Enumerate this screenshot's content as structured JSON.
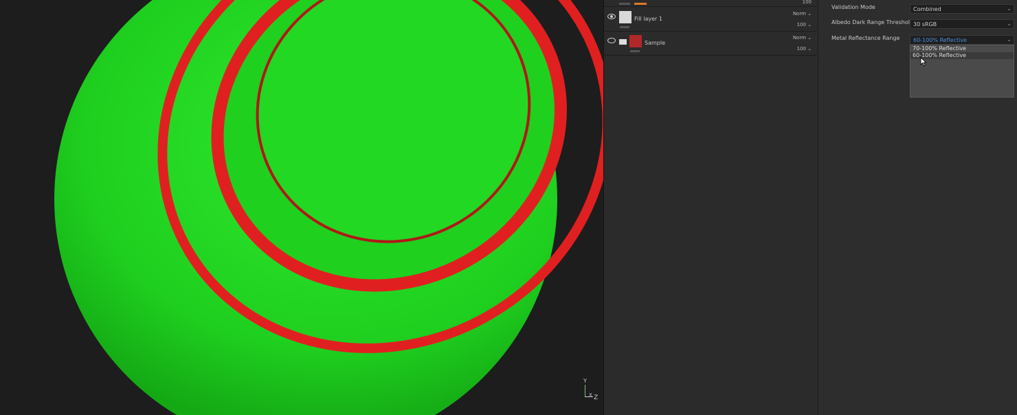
{
  "viewport": {
    "axis": {
      "y": "Y",
      "x": "X",
      "z": "Z"
    },
    "colors": {
      "valid": "#22dd22",
      "invalid": "#e02020"
    }
  },
  "layers": {
    "top_partial": {
      "opacity": "100"
    },
    "items": [
      {
        "name": "Fill layer 1",
        "blend": "Norm",
        "opacity": "100",
        "visible": true
      },
      {
        "name": "Sample",
        "blend": "Norm",
        "opacity": "100",
        "visible": false
      }
    ]
  },
  "properties": {
    "validation_mode": {
      "label": "Validation Mode",
      "value": "Combined"
    },
    "albedo_threshold": {
      "label": "Albedo Dark Range Threshold",
      "value": "30 sRGB"
    },
    "metal_range": {
      "label": "Metal Reflectance Range",
      "value": "60-100% Reflective",
      "options": [
        "70-100% Reflective",
        "60-100% Reflective"
      ]
    }
  }
}
